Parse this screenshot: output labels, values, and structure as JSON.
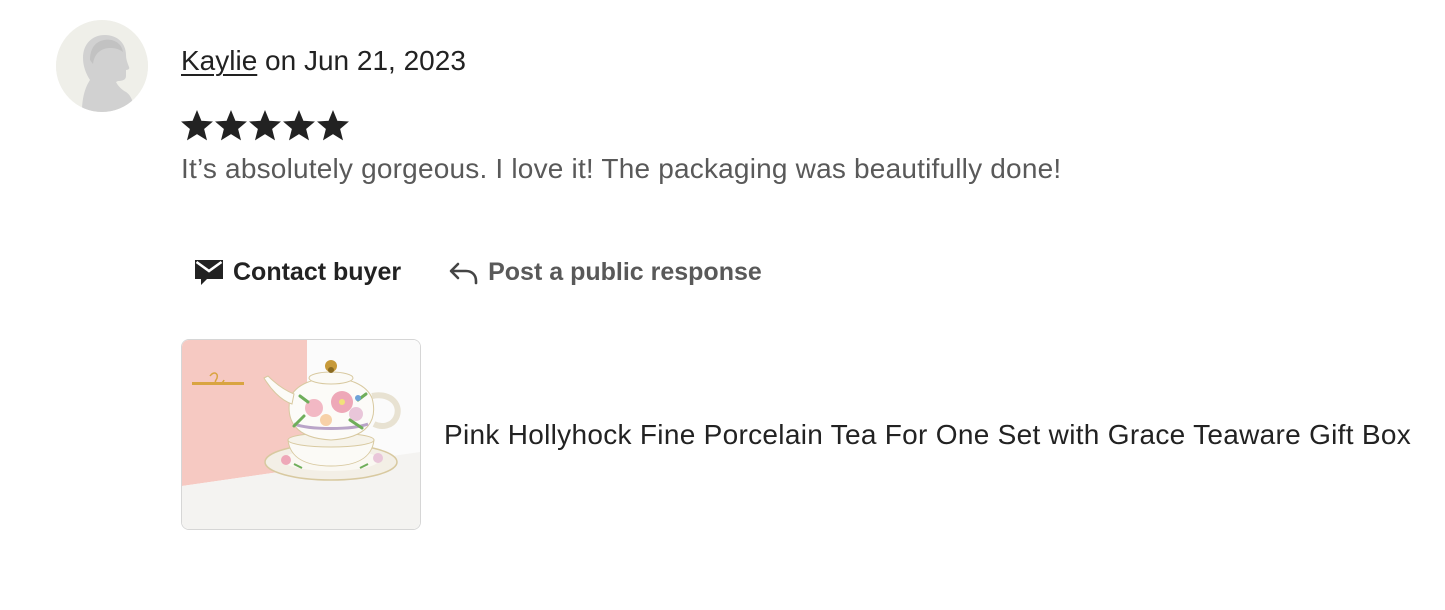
{
  "review": {
    "reviewer_name": "Kaylie",
    "date_text": "on Jun 21, 2023",
    "rating": 5,
    "rating_max": 5,
    "text": "It’s absolutely gorgeous. I love it! The packaging was beautifully done!"
  },
  "actions": {
    "contact_label": "Contact buyer",
    "contact_icon": "envelope-icon",
    "public_response_label": "Post a public response",
    "public_response_icon": "reply-arrow-icon"
  },
  "product": {
    "title": "Pink Hollyhock Fine Porcelain Tea For One Set with Grace Teaware Gift Box"
  },
  "colors": {
    "text_primary": "#222222",
    "text_secondary": "#595959",
    "star": "#222222",
    "avatar_bg": "#efefe9",
    "thumb_border": "#d6d6d6",
    "pink_box": "#f6c9c2"
  }
}
